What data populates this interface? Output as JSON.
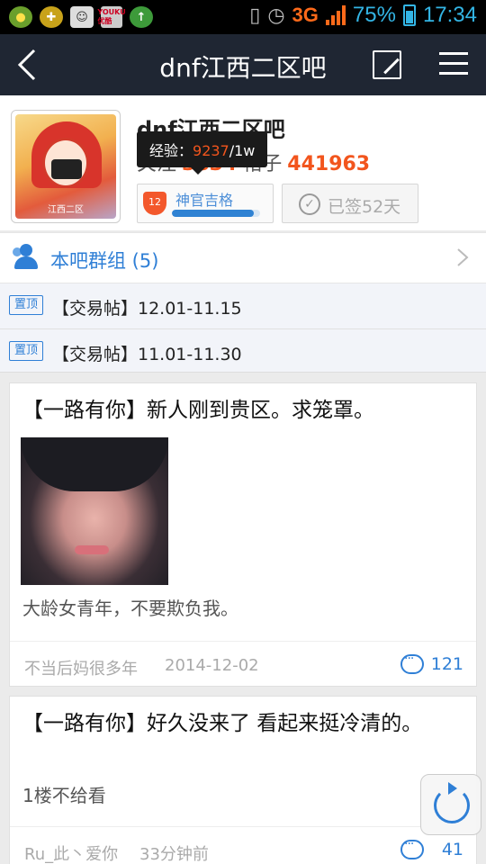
{
  "status_bar": {
    "network": "3G",
    "battery": "75%",
    "time": "17:34",
    "notification_icons": [
      "baidu-map-icon",
      "app-store-icon",
      "chat-icon",
      "youku-icon",
      "upload-icon"
    ],
    "youku_text": "YOUKU 优酷"
  },
  "title_bar": {
    "title": "dnf江西二区吧",
    "back_icon": "chevron-left-icon",
    "edit_icon": "compose-icon",
    "menu_icon": "hamburger-icon"
  },
  "header": {
    "forum_name": "dnf江西二区吧",
    "avatar_caption": "江西二区",
    "followers_label": "关注",
    "followers_count": "3834",
    "posts_label": "帖子",
    "posts_count": "441963",
    "tooltip_label": "经验：",
    "tooltip_exp": "9237",
    "tooltip_max": "/1w",
    "level_number": "12",
    "level_title": "神官吉格",
    "level_progress": 0.9237,
    "sign_label": "已签52天"
  },
  "group": {
    "label": "本吧群组 (5)"
  },
  "pinned": [
    {
      "tag": "置顶",
      "title": "【交易帖】12.01-11.15"
    },
    {
      "tag": "置顶",
      "title": "【交易帖】11.01-11.30"
    }
  ],
  "posts": [
    {
      "title": "【一路有你】新人刚到贵区。求笼罩。",
      "body": "大龄女青年，不要欺负我。",
      "author": "不当后妈很多年",
      "time": "2014-12-02",
      "replies": "121"
    },
    {
      "title": "【一路有你】好久没来了 看起来挺冷清的。",
      "body": "1楼不给看",
      "author": "Ru_此丶爱你",
      "time": "33分钟前",
      "replies": "41"
    }
  ],
  "colors": {
    "titlebar_bg": "#1f2633",
    "accent_blue": "#2f7fd6",
    "accent_orange": "#f2551d"
  }
}
